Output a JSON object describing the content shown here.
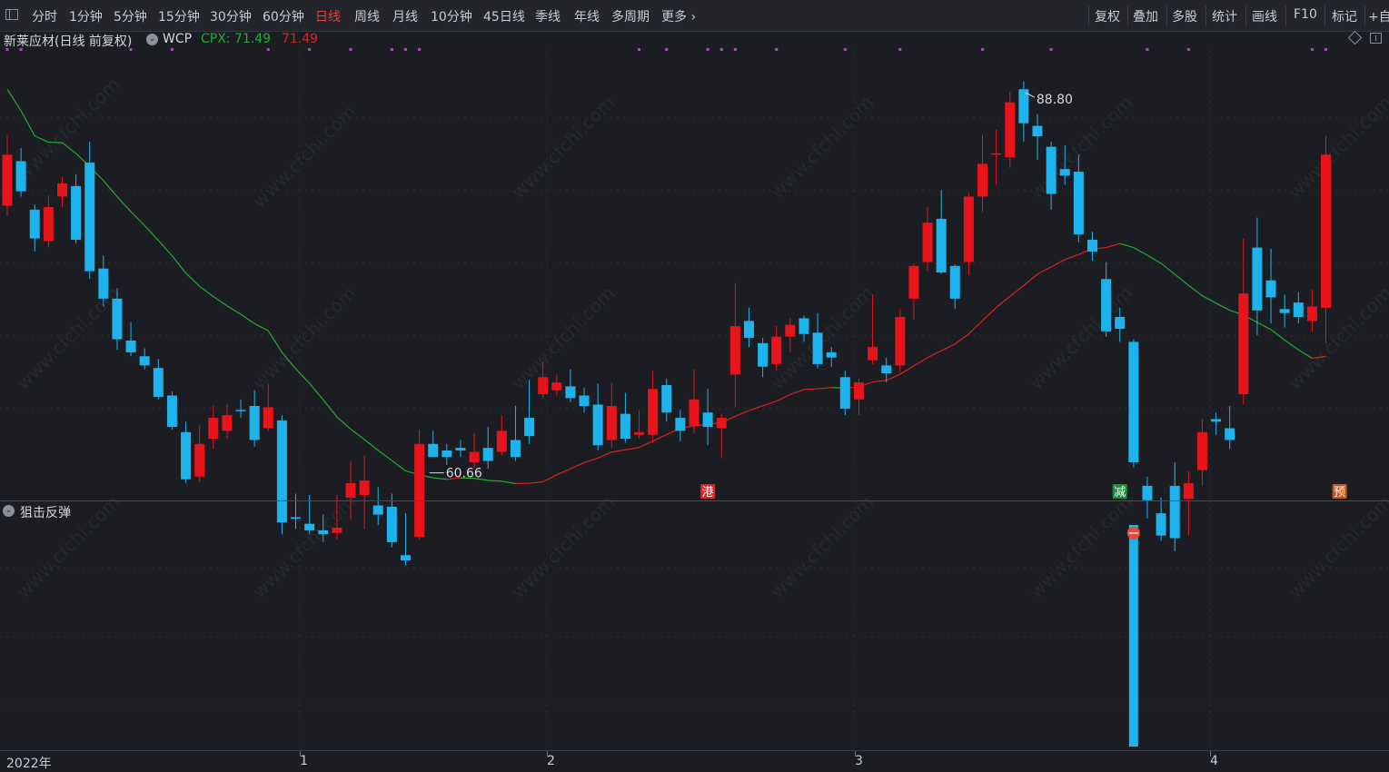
{
  "toolbar": {
    "periods": [
      "分时",
      "1分钟",
      "5分钟",
      "15分钟",
      "30分钟",
      "60分钟",
      "日线",
      "周线",
      "月线",
      "10分钟",
      "45日线",
      "季线",
      "年线",
      "多周期",
      "更多"
    ],
    "active_period": "日线",
    "right_buttons": [
      "复权",
      "叠加",
      "多股",
      "统计",
      "画线",
      "F10",
      "标记",
      "+自"
    ]
  },
  "info": {
    "title": "新莱应材(日线 前复权)",
    "indicator": "WCP",
    "cpx_label": "CPX: 71.49",
    "cpx_value2": "71.49"
  },
  "colors": {
    "up": "#e8141b",
    "down": "#1fb3ee",
    "ma_green": "#1fae2e",
    "ma_red": "#d8241f",
    "signal_dot": "#c23ad7"
  },
  "annotations": {
    "high_label": "88.80",
    "low_label": "60.66"
  },
  "markers": [
    {
      "text": "港",
      "color": "#d8262a"
    },
    {
      "text": "减",
      "color": "#1e8e3a"
    },
    {
      "text": "预",
      "color": "#c4561e"
    }
  ],
  "sub_indicator": {
    "name": "狙击反弹"
  },
  "xaxis": [
    "2022年",
    "1",
    "2",
    "3",
    "4"
  ],
  "watermark": "www.cfchi.com",
  "chart_data": {
    "type": "candlestick",
    "y_min": 58,
    "y_max": 92,
    "high_value": 88.8,
    "low_value": 60.66,
    "candles": [
      [
        80.1,
        84.0,
        85.5,
        79.3
      ],
      [
        83.5,
        81.2,
        84.5,
        80.8
      ],
      [
        79.8,
        77.6,
        80.2,
        76.6
      ],
      [
        77.4,
        80.0,
        80.9,
        76.9
      ],
      [
        80.8,
        81.8,
        82.3,
        80.0
      ],
      [
        81.6,
        77.5,
        82.5,
        77.2
      ],
      [
        83.4,
        75.1,
        85.0,
        74.5
      ],
      [
        75.3,
        73.0,
        76.3,
        72.4
      ],
      [
        73.0,
        69.9,
        73.8,
        69.1
      ],
      [
        69.8,
        68.9,
        71.2,
        68.6
      ],
      [
        68.6,
        67.9,
        69.2,
        67.6
      ],
      [
        67.7,
        65.5,
        68.4,
        65.3
      ],
      [
        65.6,
        63.2,
        65.9,
        63.0
      ],
      [
        62.8,
        59.2,
        63.6,
        58.9
      ],
      [
        59.4,
        61.9,
        63.3,
        59.0
      ],
      [
        62.3,
        63.9,
        64.8,
        61.5
      ],
      [
        62.9,
        64.1,
        64.9,
        62.3
      ],
      [
        64.5,
        64.4,
        65.3,
        63.9
      ],
      [
        64.8,
        62.2,
        66.0,
        61.7
      ],
      [
        63.1,
        64.7,
        66.5,
        62.9
      ],
      [
        63.7,
        55.9,
        64.1,
        55.0
      ],
      [
        56.3,
        56.2,
        58.1,
        55.4
      ],
      [
        55.8,
        55.3,
        58.0,
        55.0
      ],
      [
        55.3,
        55.0,
        56.5,
        54.4
      ],
      [
        55.1,
        55.5,
        58.0,
        54.6
      ],
      [
        57.8,
        58.9,
        60.6,
        56.1
      ],
      [
        58.0,
        59.1,
        61.0,
        55.4
      ],
      [
        57.2,
        56.5,
        58.6,
        55.7
      ],
      [
        57.1,
        54.4,
        58.1,
        54.0
      ],
      [
        53.4,
        53.0,
        56.6,
        52.6
      ],
      [
        54.8,
        61.9,
        63.0,
        54.6
      ],
      [
        61.9,
        60.9,
        62.9,
        60.9
      ],
      [
        61.4,
        60.9,
        61.9,
        60.3
      ],
      [
        61.6,
        61.4,
        62.2,
        60.9
      ],
      [
        60.5,
        61.3,
        62.7,
        60.1
      ],
      [
        61.6,
        60.6,
        63.2,
        60.0
      ],
      [
        61.3,
        62.9,
        64.1,
        61.0
      ],
      [
        62.2,
        60.9,
        64.8,
        60.6
      ],
      [
        63.9,
        62.5,
        66.8,
        61.9
      ],
      [
        65.7,
        67.0,
        68.2,
        65.4
      ],
      [
        66.0,
        66.6,
        67.2,
        65.6
      ],
      [
        66.3,
        65.4,
        67.6,
        65.1
      ],
      [
        65.6,
        64.8,
        66.2,
        64.3
      ],
      [
        64.9,
        61.8,
        66.5,
        61.4
      ],
      [
        62.2,
        64.8,
        66.6,
        61.6
      ],
      [
        64.2,
        62.3,
        65.8,
        62.0
      ],
      [
        62.6,
        62.8,
        64.5,
        62.3
      ],
      [
        62.6,
        66.1,
        67.5,
        62.0
      ],
      [
        66.4,
        64.3,
        66.9,
        63.6
      ],
      [
        63.9,
        62.9,
        64.5,
        62.1
      ],
      [
        63.3,
        65.3,
        67.6,
        62.7
      ],
      [
        64.3,
        63.2,
        66.1,
        61.8
      ],
      [
        63.1,
        63.9,
        64.2,
        60.8
      ],
      [
        67.2,
        70.9,
        74.2,
        64.7
      ],
      [
        71.3,
        70.0,
        72.3,
        69.3
      ],
      [
        69.6,
        67.8,
        70.0,
        67.0
      ],
      [
        68.0,
        70.1,
        70.9,
        67.5
      ],
      [
        70.1,
        71.0,
        71.5,
        68.9
      ],
      [
        71.5,
        70.3,
        71.7,
        69.7
      ],
      [
        70.4,
        68.0,
        71.9,
        67.7
      ],
      [
        68.9,
        68.5,
        69.3,
        67.8
      ],
      [
        67.0,
        64.6,
        67.5,
        64.1
      ],
      [
        65.3,
        66.6,
        66.9,
        64.1
      ],
      [
        68.3,
        69.3,
        73.3,
        68.0
      ],
      [
        67.9,
        67.3,
        68.5,
        66.6
      ],
      [
        67.9,
        71.6,
        72.2,
        67.4
      ],
      [
        73.0,
        75.5,
        75.7,
        71.4
      ],
      [
        75.8,
        78.8,
        80.0,
        75.1
      ],
      [
        79.1,
        75.0,
        81.3,
        74.9
      ],
      [
        75.5,
        73.0,
        75.6,
        72.2
      ],
      [
        75.8,
        80.8,
        81.1,
        74.8
      ],
      [
        80.8,
        83.3,
        85.5,
        79.6
      ],
      [
        84.1,
        84.1,
        85.9,
        81.7
      ],
      [
        83.8,
        88.0,
        88.8,
        83.0
      ],
      [
        89.0,
        86.4,
        89.6,
        85.0
      ],
      [
        86.2,
        85.4,
        87.1,
        83.6
      ],
      [
        84.6,
        81.0,
        85.0,
        79.8
      ],
      [
        82.9,
        82.4,
        84.7,
        81.7
      ],
      [
        82.7,
        77.9,
        84.0,
        77.3
      ],
      [
        77.5,
        76.6,
        78.1,
        75.9
      ],
      [
        74.5,
        70.5,
        75.8,
        70.1
      ],
      [
        71.6,
        70.7,
        72.3,
        69.7
      ],
      [
        69.7,
        60.5,
        69.9,
        60.1
      ],
      [
        58.7,
        57.6,
        59.4,
        56.2
      ],
      [
        56.6,
        54.9,
        57.8,
        54.5
      ],
      [
        58.7,
        54.7,
        60.5,
        53.7
      ],
      [
        57.7,
        58.9,
        59.8,
        54.9
      ],
      [
        59.9,
        62.8,
        63.8,
        58.7
      ],
      [
        63.8,
        63.6,
        64.3,
        62.6
      ],
      [
        63.1,
        62.2,
        64.8,
        61.5
      ],
      [
        65.7,
        73.4,
        77.6,
        64.9
      ],
      [
        76.9,
        72.1,
        79.2,
        70.2
      ],
      [
        74.4,
        73.1,
        76.8,
        71.1
      ],
      [
        72.2,
        71.9,
        73.3,
        70.8
      ],
      [
        72.7,
        71.6,
        73.5,
        71.1
      ],
      [
        71.3,
        72.4,
        73.7,
        70.5
      ],
      [
        72.3,
        84.0,
        85.4,
        69.6
      ]
    ]
  }
}
